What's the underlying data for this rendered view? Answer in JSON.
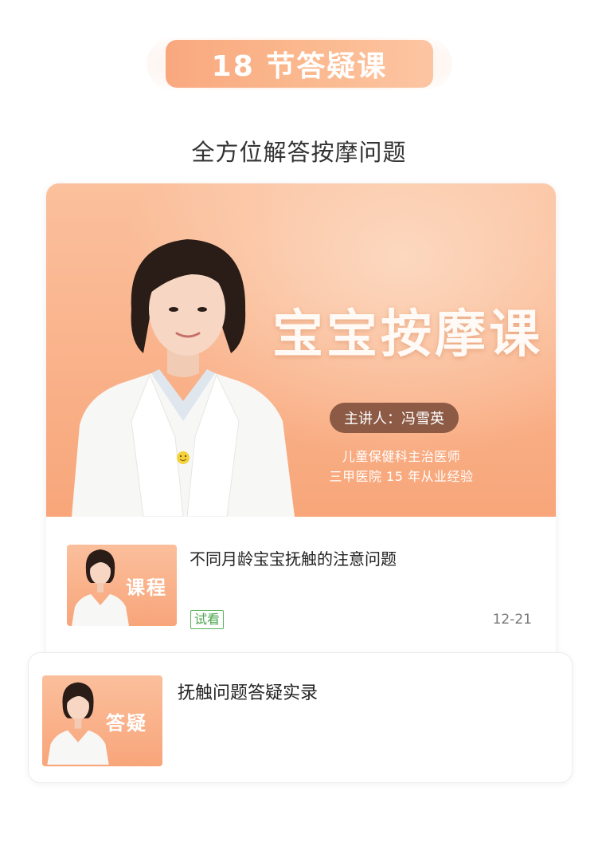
{
  "header": {
    "badge_text": "18 节答疑课",
    "subtitle": "全方位解答按摩问题"
  },
  "hero": {
    "title": "宝宝按摩课",
    "speaker": "主讲人：冯雪英",
    "credential_1": "儿童保健科主治医师",
    "credential_2": "三甲医院 15 年从业经验"
  },
  "lessons": [
    {
      "thumb_label": "课程",
      "title": "不同月龄宝宝抚触的注意问题",
      "tag": "试看",
      "date": "12-21"
    },
    {
      "thumb_label": "答疑",
      "title": "抚触问题答疑实录"
    }
  ],
  "colors": {
    "accent_orange": "#f9a87e",
    "speaker_badge": "#8c5a45",
    "trial_tag": "#4aa64c"
  }
}
